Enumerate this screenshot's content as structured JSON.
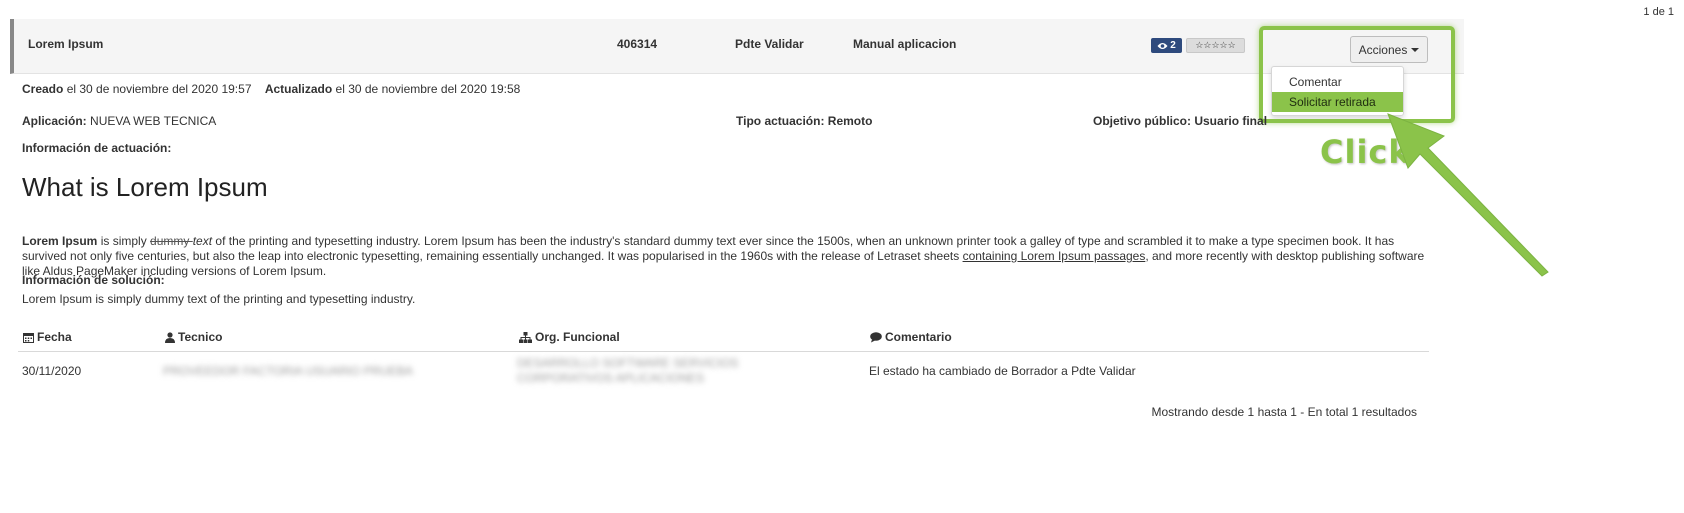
{
  "pagination": {
    "page_info": "1 de 1"
  },
  "header": {
    "title": "Lorem Ipsum",
    "id": "406314",
    "status": "Pdte Validar",
    "type": "Manual aplicacion",
    "views_count": "2",
    "stars": "☆☆☆☆☆",
    "actions_label": "Acciones"
  },
  "actions_menu": {
    "items": [
      "Comentar",
      "Solicitar retirada"
    ],
    "highlighted_index": 1
  },
  "annotation": {
    "click_label": "Click",
    "color": "#8bc34a"
  },
  "meta": {
    "created_label": "Creado",
    "created_value": "el 30 de noviembre del 2020 19:57",
    "updated_label": "Actualizado",
    "updated_value": "el 30 de noviembre del 2020 19:58"
  },
  "info": {
    "app_label": "Aplicación:",
    "app_value": "NUEVA WEB TECNICA",
    "tipo_label": "Tipo actuación:",
    "tipo_value": "Remoto",
    "objetivo_label": "Objetivo público:",
    "objetivo_value": "Usuario final",
    "actuacion_label": "Información de actuación:"
  },
  "content": {
    "heading": "What is Lorem Ipsum",
    "p_bold": "Lorem Ipsum",
    "p_part1": " is simply ",
    "p_strike": "dummy ",
    "p_italic": "text",
    "p_part2": " of the printing and typesetting industry. Lorem Ipsum has been the industry's standard dummy text ever since the 1500s, when an unknown printer took a galley of type and scrambled it to make a type specimen book. It has survived not only five centuries, but also the leap into electronic typesetting, remaining essentially unchanged. It was popularised in the 1960s with the release of Letraset sheets ",
    "p_link": "containing Lorem Ipsum passages",
    "p_part3": ", and more recently with desktop publishing software like Aldus PageMaker including versions of Lorem Ipsum."
  },
  "solution": {
    "label": "Información de solución:",
    "text": "Lorem Ipsum is simply dummy text of the printing and typesetting industry."
  },
  "history_table": {
    "columns": [
      "Fecha",
      "Tecnico",
      "Org. Funcional",
      "Comentario"
    ],
    "rows": [
      {
        "fecha": "30/11/2020",
        "tecnico": "PROVEEDOR FACTORIA USUARIO PRUEBA",
        "org": "DESARROLLO SOFTWARE SERVICIOS CORPORATIVOS APLICACIONES",
        "comentario": "El estado ha cambiado de Borrador a Pdte Validar"
      }
    ],
    "summary": "Mostrando desde 1 hasta 1 - En total 1 resultados"
  }
}
